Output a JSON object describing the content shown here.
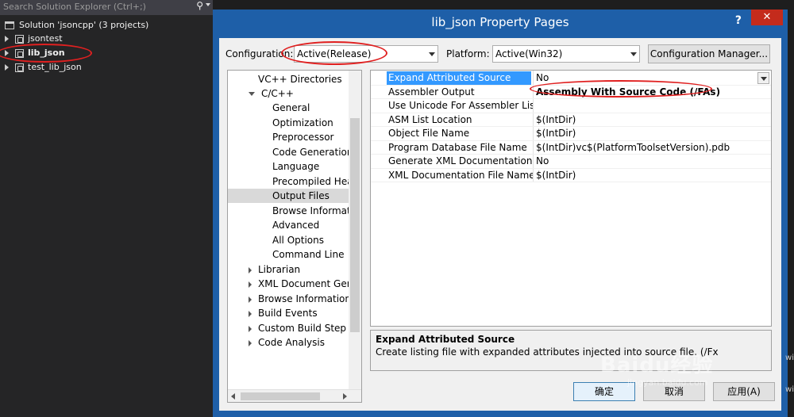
{
  "solution_explorer": {
    "search_placeholder": "Search Solution Explorer (Ctrl+;)",
    "solution_label": "Solution 'jsoncpp' (3 projects)",
    "projects": [
      "jsontest",
      "lib_json",
      "test_lib_json"
    ]
  },
  "dialog": {
    "title": "lib_json Property Pages",
    "help": "?",
    "close": "✕",
    "configuration_label": "Configuration:",
    "configuration_value": "Active(Release)",
    "platform_label": "Platform:",
    "platform_value": "Active(Win32)",
    "config_manager_button": "Configuration Manager...",
    "tree": [
      "VC++ Directories",
      "C/C++",
      "General",
      "Optimization",
      "Preprocessor",
      "Code Generation",
      "Language",
      "Precompiled Headers",
      "Output Files",
      "Browse Information",
      "Advanced",
      "All Options",
      "Command Line",
      "Librarian",
      "XML Document Generator",
      "Browse Information",
      "Build Events",
      "Custom Build Step",
      "Code Analysis"
    ],
    "properties": [
      {
        "name": "Expand Attributed Source",
        "value": "No"
      },
      {
        "name": "Assembler Output",
        "value": "Assembly With Source Code (/FAs)"
      },
      {
        "name": "Use Unicode For Assembler Listing",
        "value": ""
      },
      {
        "name": "ASM List Location",
        "value": "$(IntDir)"
      },
      {
        "name": "Object File Name",
        "value": "$(IntDir)"
      },
      {
        "name": "Program Database File Name",
        "value": "$(IntDir)vc$(PlatformToolsetVersion).pdb"
      },
      {
        "name": "Generate XML Documentation Files",
        "value": "No"
      },
      {
        "name": "XML Documentation File Name",
        "value": "$(IntDir)"
      }
    ],
    "description_title": "Expand Attributed Source",
    "description_text": "Create listing file with expanded attributes injected into source file.   (/Fx",
    "ok_button": "确定",
    "cancel_button": "取消",
    "apply_button": "应用(A)"
  },
  "watermark": {
    "brand": "Baidu经验",
    "url": "jingyan.baidu.com"
  },
  "edge_text": [
    "wi",
    "wi"
  ],
  "colors": {
    "dialog_title_bar": "#1e5fa8",
    "close_button": "#c42b1c",
    "selection": "#3399ff",
    "annotation": "#e02020"
  }
}
